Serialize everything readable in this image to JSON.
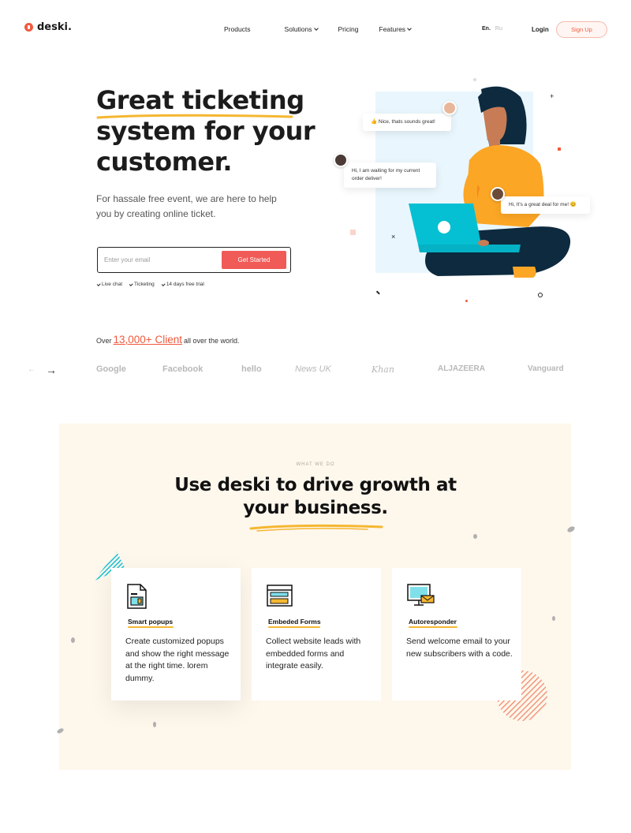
{
  "brand": {
    "name": "deski."
  },
  "nav": {
    "items": [
      {
        "label": "Products",
        "has_dropdown": false
      },
      {
        "label": "Solutions",
        "has_dropdown": true
      },
      {
        "label": "Pricing",
        "has_dropdown": false
      },
      {
        "label": "Features",
        "has_dropdown": true
      }
    ],
    "lang_en": "En.",
    "lang_ru": "Ru",
    "login": "Login",
    "signup": "Sign Up"
  },
  "hero": {
    "title_lines": [
      "Great ticketing",
      "system for your",
      "customer."
    ],
    "subtitle": "For hassale free event, we are here to help you by creating online ticket.",
    "email_placeholder": "Enter your email",
    "cta": "Get Started",
    "features": [
      "Live chat",
      "Ticketing",
      "14 days free trial"
    ]
  },
  "illustration": {
    "bubble_1": "Nice, thats sounds great!",
    "bubble_2": "Hi, I am waiting for my current order deliver!",
    "bubble_3": "Hi, It's a great deal for me! 😊"
  },
  "clients": {
    "prefix": "Over",
    "count": "13,000+ Client",
    "suffix": "all over the world.",
    "logos": [
      "Google",
      "Facebook",
      "hello",
      "News UK",
      "Khan",
      "ALJAZEERA",
      "Vanguard"
    ]
  },
  "what_we_do": {
    "eyebrow": "WHAT WE DO",
    "title_line_1": "Use deski to drive growth at",
    "title_line_2": "your business.",
    "cards": [
      {
        "label": "Smart popups",
        "body": "Create customized popups and show the right message at the right time. lorem dummy.",
        "icon": "document-icon"
      },
      {
        "label": "Embeded Forms",
        "body": "Collect website leads with embedded forms and integrate easily.",
        "icon": "browser-form-icon"
      },
      {
        "label": "Autoresponder",
        "body": "Send welcome email to your new subscribers with a code.",
        "icon": "monitor-mail-icon"
      }
    ]
  },
  "colors": {
    "accent": "#f05a3e",
    "button": "#f05a57",
    "underline": "#f5b731",
    "section_bg": "#fef7ec"
  }
}
